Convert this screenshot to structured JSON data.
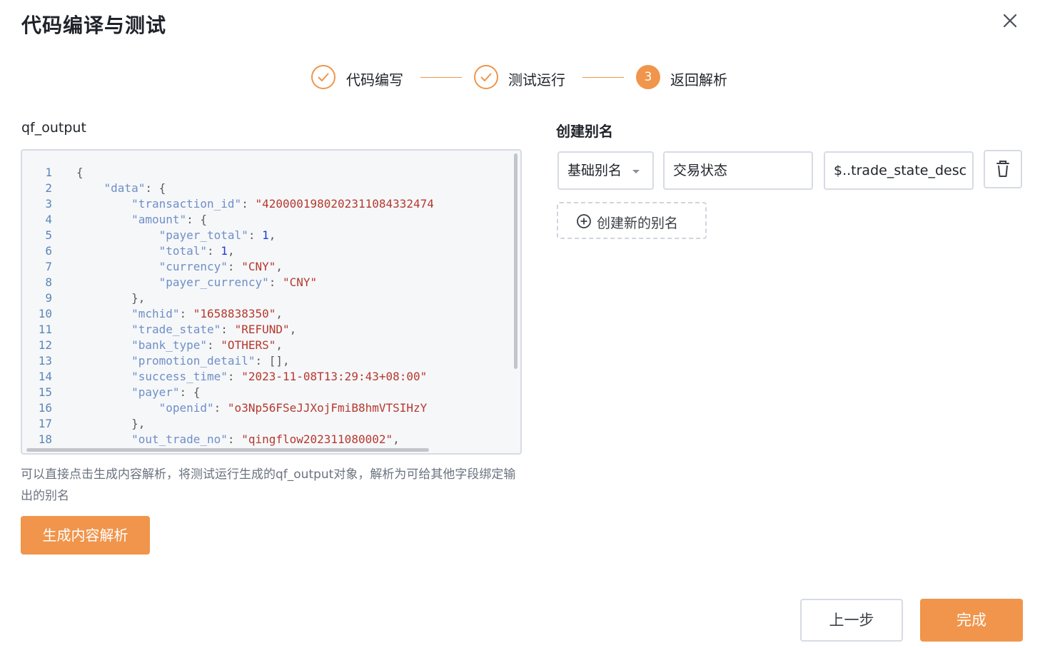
{
  "dialog": {
    "title": "代码编译与测试",
    "close_icon": "close-icon"
  },
  "steps": [
    {
      "label": "代码编写",
      "status": "done"
    },
    {
      "label": "测试运行",
      "status": "done"
    },
    {
      "label": "返回解析",
      "status": "active",
      "number": "3"
    }
  ],
  "output": {
    "label": "qf_output",
    "code_lines": [
      {
        "no": "1",
        "html": "{"
      },
      {
        "no": "2",
        "html": "    <span class=\"k\">\"data\"</span>: {"
      },
      {
        "no": "3",
        "html": "        <span class=\"k\">\"transaction_id\"</span>: <span class=\"s\">\"4200001980202311084332474</span>"
      },
      {
        "no": "4",
        "html": "        <span class=\"k\">\"amount\"</span>: {"
      },
      {
        "no": "5",
        "html": "            <span class=\"k\">\"payer_total\"</span>: <span class=\"n\">1</span>,"
      },
      {
        "no": "6",
        "html": "            <span class=\"k\">\"total\"</span>: <span class=\"n\">1</span>,"
      },
      {
        "no": "7",
        "html": "            <span class=\"k\">\"currency\"</span>: <span class=\"s\">\"CNY\"</span>,"
      },
      {
        "no": "8",
        "html": "            <span class=\"k\">\"payer_currency\"</span>: <span class=\"s\">\"CNY\"</span>"
      },
      {
        "no": "9",
        "html": "        },"
      },
      {
        "no": "10",
        "html": "        <span class=\"k\">\"mchid\"</span>: <span class=\"s\">\"1658838350\"</span>,"
      },
      {
        "no": "11",
        "html": "        <span class=\"k\">\"trade_state\"</span>: <span class=\"s\">\"REFUND\"</span>,"
      },
      {
        "no": "12",
        "html": "        <span class=\"k\">\"bank_type\"</span>: <span class=\"s\">\"OTHERS\"</span>,"
      },
      {
        "no": "13",
        "html": "        <span class=\"k\">\"promotion_detail\"</span>: [],"
      },
      {
        "no": "14",
        "html": "        <span class=\"k\">\"success_time\"</span>: <span class=\"s\">\"2023-11-08T13:29:43+08:00\"</span>"
      },
      {
        "no": "15",
        "html": "        <span class=\"k\">\"payer\"</span>: {"
      },
      {
        "no": "16",
        "html": "            <span class=\"k\">\"openid\"</span>: <span class=\"s\">\"o3Np56FSeJJXojFmiB8hmVTSIHzY</span>"
      },
      {
        "no": "17",
        "html": "        },"
      },
      {
        "no": "18",
        "html": "        <span class=\"k\">\"out_trade_no\"</span>: <span class=\"s\">\"qingflow202311080002\"</span>,"
      }
    ],
    "hint": "可以直接点击生成内容解析，将测试运行生成的qf_output对象，解析为可给其他字段绑定输出的别名",
    "generate_button": "生成内容解析"
  },
  "alias": {
    "title": "创建别名",
    "type_select": "基础别名",
    "name_value": "交易状态",
    "path_value": "$..trade_state_desc",
    "delete_icon": "trash-icon",
    "add_button": "创建新的别名",
    "add_icon": "plus-circle-icon"
  },
  "footer": {
    "prev_button": "上一步",
    "done_button": "完成"
  },
  "colors": {
    "accent": "#f0954b",
    "border": "#d7dbe3"
  }
}
